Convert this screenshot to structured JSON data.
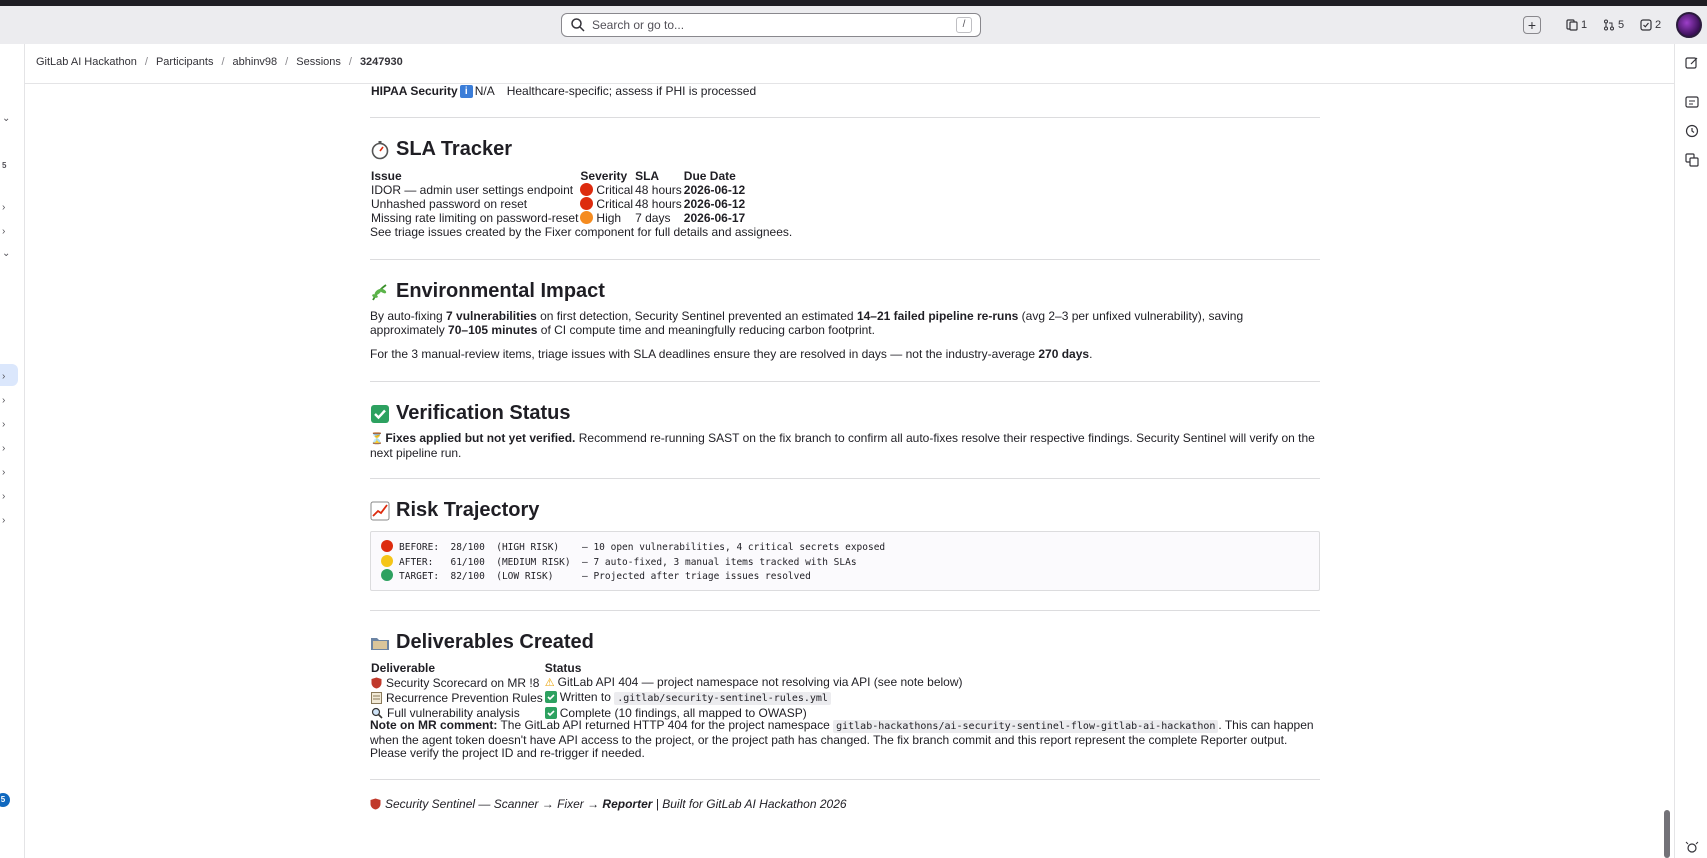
{
  "topbar": {
    "search_placeholder": "Search or go to...",
    "search_shortcut": "/",
    "issues_count": "1",
    "mrs_count": "5",
    "todos_count": "2"
  },
  "breadcrumbs": [
    "GitLab AI Hackathon",
    "Participants",
    "abhinv98",
    "Sessions",
    "3247930"
  ],
  "hipaa": {
    "label": "HIPAA Security",
    "value": "N/A",
    "note": "Healthcare-specific; assess if PHI is processed"
  },
  "sla": {
    "heading": "SLA Tracker",
    "headers": [
      "Issue",
      "Severity",
      "SLA",
      "Due Date"
    ],
    "rows": [
      {
        "issue": "IDOR — admin user settings endpoint",
        "severity": "Critical",
        "sla": "48 hours",
        "due": "2026-06-12",
        "color": "#dd2b0e"
      },
      {
        "issue": "Unhashed password on reset",
        "severity": "Critical",
        "sla": "48 hours",
        "due": "2026-06-12",
        "color": "#dd2b0e"
      },
      {
        "issue": "Missing rate limiting on password-reset",
        "severity": "High",
        "sla": "7 days",
        "due": "2026-06-17",
        "color": "#f58b1f"
      }
    ],
    "footnote": "See triage issues created by the Fixer component for full details and assignees."
  },
  "env": {
    "heading": "Environmental Impact",
    "p1_a": "By auto-fixing ",
    "p1_b": "7 vulnerabilities",
    "p1_c": " on first detection, Security Sentinel prevented an estimated ",
    "p1_d": "14–21 failed pipeline re-runs",
    "p1_e": " (avg 2–3 per unfixed vulnerability), saving approximately ",
    "p1_f": "70–105 minutes",
    "p1_g": " of CI compute time and meaningfully reducing carbon footprint.",
    "p2_a": "For the 3 manual-review items, triage issues with SLA deadlines ensure they are resolved in days — not the industry-average ",
    "p2_b": "270 days",
    "p2_c": "."
  },
  "verify": {
    "heading": "Verification Status",
    "bold": "Fixes applied but not yet verified.",
    "rest": " Recommend re-running SAST on the fix branch to confirm all auto-fixes resolve their respective findings. Security Sentinel will verify on the next pipeline run."
  },
  "risk": {
    "heading": "Risk Trajectory",
    "lines": [
      {
        "text": "BEFORE:  28/100  (HIGH RISK)    — 10 open vulnerabilities, 4 critical secrets exposed",
        "color": "#dd2b0e"
      },
      {
        "text": "AFTER:   61/100  (MEDIUM RISK)  — 7 auto-fixed, 3 manual items tracked with SLAs",
        "color": "#f5c518"
      },
      {
        "text": "TARGET:  82/100  (LOW RISK)     — Projected after triage issues resolved",
        "color": "#2da160"
      }
    ]
  },
  "deliverables": {
    "heading": "Deliverables Created",
    "headers": [
      "Deliverable",
      "Status"
    ],
    "rows": [
      {
        "name": "Security Scorecard on MR !8",
        "status": "GitLab API 404 — project namespace not resolving via API (see note below)",
        "code": ""
      },
      {
        "name": "Recurrence Prevention Rules",
        "status": "Written to ",
        "code": ".gitlab/security-sentinel-rules.yml"
      },
      {
        "name": "Full vulnerability analysis",
        "status": "Complete (10 findings, all mapped to OWASP)",
        "code": ""
      }
    ],
    "note_label": "Note on MR comment:",
    "note_a": " The GitLab API returned HTTP 404 for the project namespace ",
    "note_code": "gitlab-hackathons/ai-security-sentinel-flow-gitlab-ai-hackathon",
    "note_b": ". This can happen when the agent token doesn't have API access to the project, or the project path has changed. The fix branch commit and this report represent the complete Reporter output. Please verify the project ID and re-trigger if needed."
  },
  "footer": {
    "a": "Security Sentinel — Scanner → Fixer → ",
    "b": "Reporter",
    "c": " | Built for GitLab AI Hackathon 2026"
  }
}
